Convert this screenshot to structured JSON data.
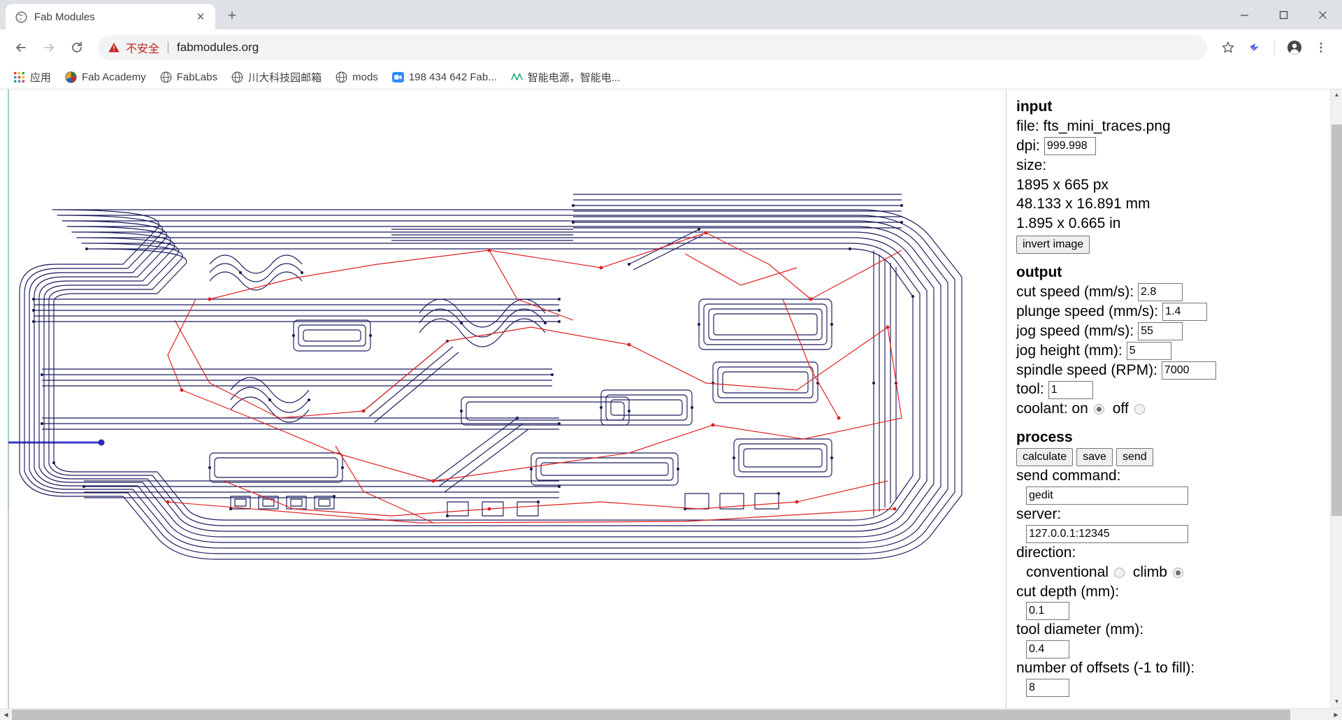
{
  "window": {
    "minimize_label": "—",
    "maximize_label": "❐",
    "close_label": "✕"
  },
  "tab": {
    "title": "Fab Modules",
    "favicon": "globe-icon",
    "close_label": "✕",
    "newtab_label": "+"
  },
  "toolbar": {
    "back_label": "←",
    "forward_label": "→",
    "reload_label": "⟳",
    "security_text": "不安全",
    "url": "fabmodules.org",
    "bookmark_star": "☆",
    "extension_icon": "extension-bird-icon",
    "profile_icon": "profile-avatar-icon",
    "menu_label": "⋮"
  },
  "bookmarks": [
    {
      "label": "应用",
      "icon": "apps-grid-icon"
    },
    {
      "label": "Fab Academy",
      "icon": "fab-academy-icon"
    },
    {
      "label": "FabLabs",
      "icon": "globe-icon"
    },
    {
      "label": "川大科技园邮箱",
      "icon": "globe-icon"
    },
    {
      "label": "mods",
      "icon": "globe-icon"
    },
    {
      "label": "198 434 642 Fab...",
      "icon": "zoom-camera-icon"
    },
    {
      "label": "智能电源，智能电...",
      "icon": "waveform-icon"
    }
  ],
  "colors": {
    "toolpath": "#1a1a5e",
    "jog": "#e02020",
    "origin_vector": "#3838c8",
    "axis": "#9fd6b5",
    "insecure": "#c5221f"
  },
  "panel": {
    "input": {
      "heading": "input",
      "file_label": "file:",
      "file_value": "fts_mini_traces.png",
      "dpi_label": "dpi:",
      "dpi_value": "999.998",
      "size_label": "size:",
      "size_px": "1895 x 665 px",
      "size_mm": "48.133 x 16.891 mm",
      "size_in": "1.895 x 0.665 in",
      "invert_button": "invert image"
    },
    "output": {
      "heading": "output",
      "cut_speed_label": "cut speed (mm/s):",
      "cut_speed_value": "2.8",
      "plunge_speed_label": "plunge speed (mm/s):",
      "plunge_speed_value": "1.4",
      "jog_speed_label": "jog speed (mm/s):",
      "jog_speed_value": "55",
      "jog_height_label": "jog height (mm):",
      "jog_height_value": "5",
      "spindle_speed_label": "spindle speed (RPM):",
      "spindle_speed_value": "7000",
      "tool_label": "tool:",
      "tool_value": "1",
      "coolant_label": "coolant: on",
      "coolant_off_label": "off",
      "coolant_on_selected": true
    },
    "process": {
      "heading": "process",
      "calculate_button": "calculate",
      "save_button": "save",
      "send_button": "send",
      "send_command_label": "send command:",
      "send_command_value": "gedit",
      "server_label": "server:",
      "server_value": "127.0.0.1:12345",
      "direction_label": "direction:",
      "conventional_label": "conventional",
      "climb_label": "climb",
      "climb_selected": true,
      "cut_depth_label": "cut depth (mm):",
      "cut_depth_value": "0.1",
      "tool_diameter_label": "tool diameter (mm):",
      "tool_diameter_value": "0.4",
      "offsets_label": "number of offsets (-1 to fill):",
      "offsets_value": "8"
    }
  },
  "scrollbars": {
    "up_arrow": "▲",
    "down_arrow": "▼",
    "left_arrow": "◀",
    "right_arrow": "▶"
  }
}
